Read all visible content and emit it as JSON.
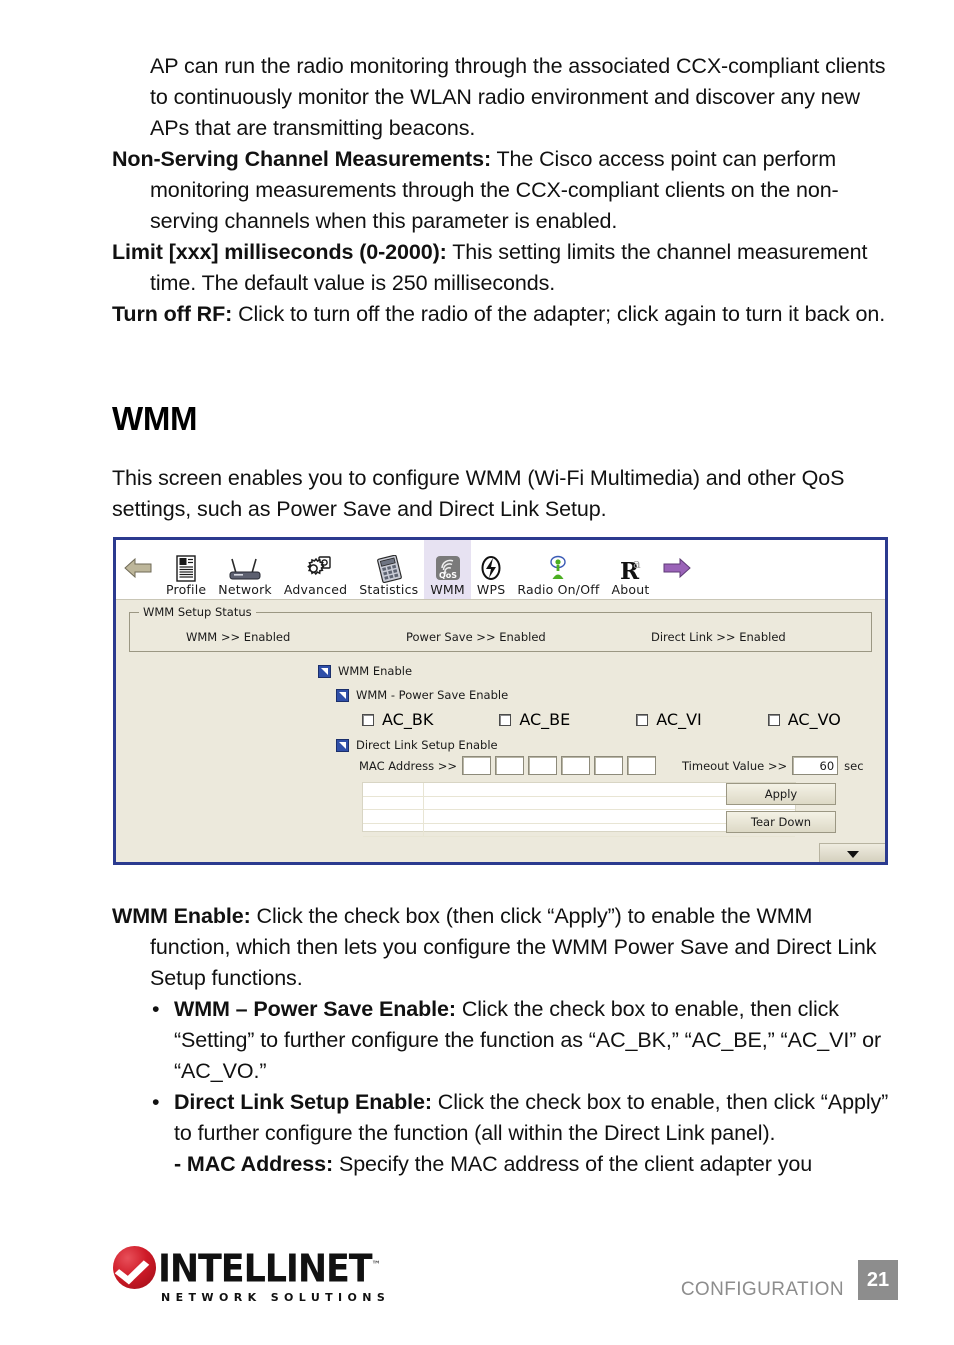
{
  "top_prose": [
    {
      "type": "plain",
      "text": "AP can run the radio monitoring through the associated CCX-compliant clients to continuously monitor the WLAN radio environment and discover any new APs that are transmitting beacons."
    },
    {
      "type": "hang",
      "lead": "Non-Serving Channel Measurements:",
      "text": " The Cisco access point can perform monitoring measurements through the CCX-compliant clients on the non-serving channels when this parameter is enabled."
    },
    {
      "type": "hang",
      "lead": "Limit [xxx] milliseconds (0-2000):",
      "text": " This setting limits the channel measurement time. The default value is 250 milliseconds."
    },
    {
      "type": "hang",
      "lead": "Turn off RF:",
      "text": " Click to turn off the radio of the adapter; click again to turn it back on."
    }
  ],
  "section": {
    "title": "WMM",
    "intro": "This screen enables you to configure WMM (Wi-Fi Multimedia) and other QoS settings, such as Power Save and Direct Link Setup."
  },
  "app": {
    "toolbar": {
      "back_icon": "left-arrow-icon",
      "forward_icon": "right-arrow-icon",
      "tabs": [
        {
          "label": "Profile",
          "icon": "profile-icon",
          "selected": false
        },
        {
          "label": "Network",
          "icon": "network-icon",
          "selected": false
        },
        {
          "label": "Advanced",
          "icon": "advanced-gear-icon",
          "selected": false
        },
        {
          "label": "Statistics",
          "icon": "statistics-icon",
          "selected": false
        },
        {
          "label": "WMM",
          "icon": "qos-icon",
          "selected": true
        },
        {
          "label": "WPS",
          "icon": "wps-icon",
          "selected": false
        },
        {
          "label": "Radio On/Off",
          "icon": "radio-antenna-icon",
          "selected": false
        },
        {
          "label": "About",
          "icon": "about-icon",
          "selected": false
        }
      ]
    },
    "status_group": {
      "title": "WMM Setup Status",
      "items": [
        "WMM >> Enabled",
        "Power Save >> Enabled",
        "Direct Link >> Enabled"
      ]
    },
    "checkboxes": {
      "wmm_enable": {
        "label": "WMM Enable",
        "checked": true
      },
      "power_save_enable": {
        "label": "WMM - Power Save Enable",
        "checked": true
      },
      "access_categories": [
        {
          "label": "AC_BK",
          "checked": false
        },
        {
          "label": "AC_BE",
          "checked": false
        },
        {
          "label": "AC_VI",
          "checked": false
        },
        {
          "label": "AC_VO",
          "checked": false
        }
      ],
      "direct_link_enable": {
        "label": "Direct Link Setup Enable",
        "checked": true
      }
    },
    "direct_link": {
      "mac_label": "MAC Address >>",
      "mac_fields": [
        "",
        "",
        "",
        "",
        "",
        ""
      ],
      "timeout_label": "Timeout Value >>",
      "timeout_value": "60",
      "timeout_unit": "sec",
      "list_rows": [
        "",
        "",
        "",
        ""
      ]
    },
    "buttons": {
      "apply": "Apply",
      "tear_down": "Tear Down",
      "collapse_icon": "chevron-down-icon"
    },
    "colors": {
      "window_border": "#2b3a8f",
      "body_bg": "#ece9dc",
      "selected_tab_bg": "#e7e2f2",
      "checkbox_checked": "#2f4fa8"
    }
  },
  "bottom_prose": [
    {
      "type": "hang",
      "lead": "WMM Enable:",
      "text": " Click the check box (then click “Apply”) to enable the WMM function, which then lets you configure the WMM Power Save and Direct Link Setup functions."
    },
    {
      "type": "bullet",
      "mark": "•",
      "lead": "WMM – Power Save Enable:",
      "text": " Click the check box to enable, then click “Setting” to further configure the function as “AC_BK,” “AC_BE,” “AC_VI” or “AC_VO.”"
    },
    {
      "type": "bullet",
      "mark": "•",
      "lead": "Direct Link Setup Enable:",
      "text": " Click the check box to enable, then click “Apply” to further configure the function (all within the Direct Link panel)."
    },
    {
      "type": "dash",
      "lead": "- MAC Address:",
      "text": " Specify the MAC address of the client adapter you"
    }
  ],
  "footer": {
    "logo_word": "INTELLINET",
    "logo_tm": "™",
    "logo_sub": "NETWORK SOLUTIONS",
    "section_label": "CONFIGURATION",
    "page_number": "21"
  }
}
